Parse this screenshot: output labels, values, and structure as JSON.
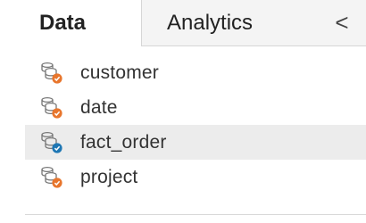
{
  "tabs": {
    "data_label": "Data",
    "analytics_label": "Analytics",
    "collapse_glyph": "<"
  },
  "data_sources": [
    {
      "label": "customer",
      "icon": "database-icon",
      "badge_color": "#e8762d",
      "selected": false
    },
    {
      "label": "date",
      "icon": "database-icon",
      "badge_color": "#e8762d",
      "selected": false
    },
    {
      "label": "fact_order",
      "icon": "database-icon",
      "badge_color": "#1f77b4",
      "selected": true
    },
    {
      "label": "project",
      "icon": "database-icon",
      "badge_color": "#e8762d",
      "selected": false
    }
  ],
  "colors": {
    "selected_row": "#ececec",
    "badge_orange": "#e8762d",
    "badge_blue": "#1f77b4"
  }
}
